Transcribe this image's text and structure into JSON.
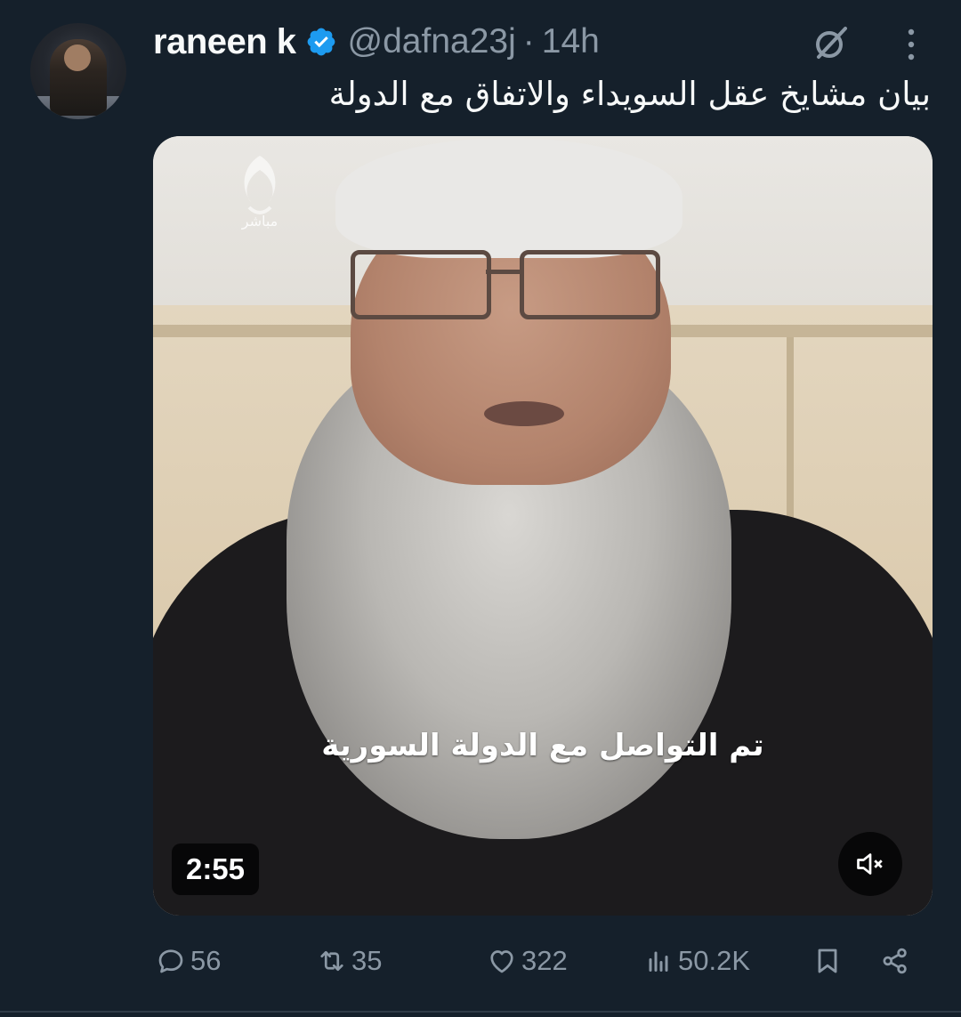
{
  "tweet": {
    "author_name": "raneen k",
    "handle": "@dafna23j",
    "separator": "·",
    "time": "14h",
    "text": "بيان مشايخ عقل السويداء والاتفاق مع الدولة",
    "verified_color": "#1d9bf0"
  },
  "media": {
    "logo_text": "مباشر",
    "caption": "تم التواصل مع الدولة السورية",
    "duration": "2:55",
    "muted": true
  },
  "actions": {
    "reply_count": "56",
    "repost_count": "35",
    "like_count": "322",
    "views_count": "50.2K"
  },
  "icons": [
    "grok-icon",
    "more-icon",
    "reply-icon",
    "repost-icon",
    "like-icon",
    "views-icon",
    "bookmark-icon",
    "share-icon",
    "mute-icon",
    "verified-icon"
  ],
  "colors": {
    "background": "#15202b",
    "text": "#f7f9f9",
    "secondary": "#8b98a5"
  }
}
